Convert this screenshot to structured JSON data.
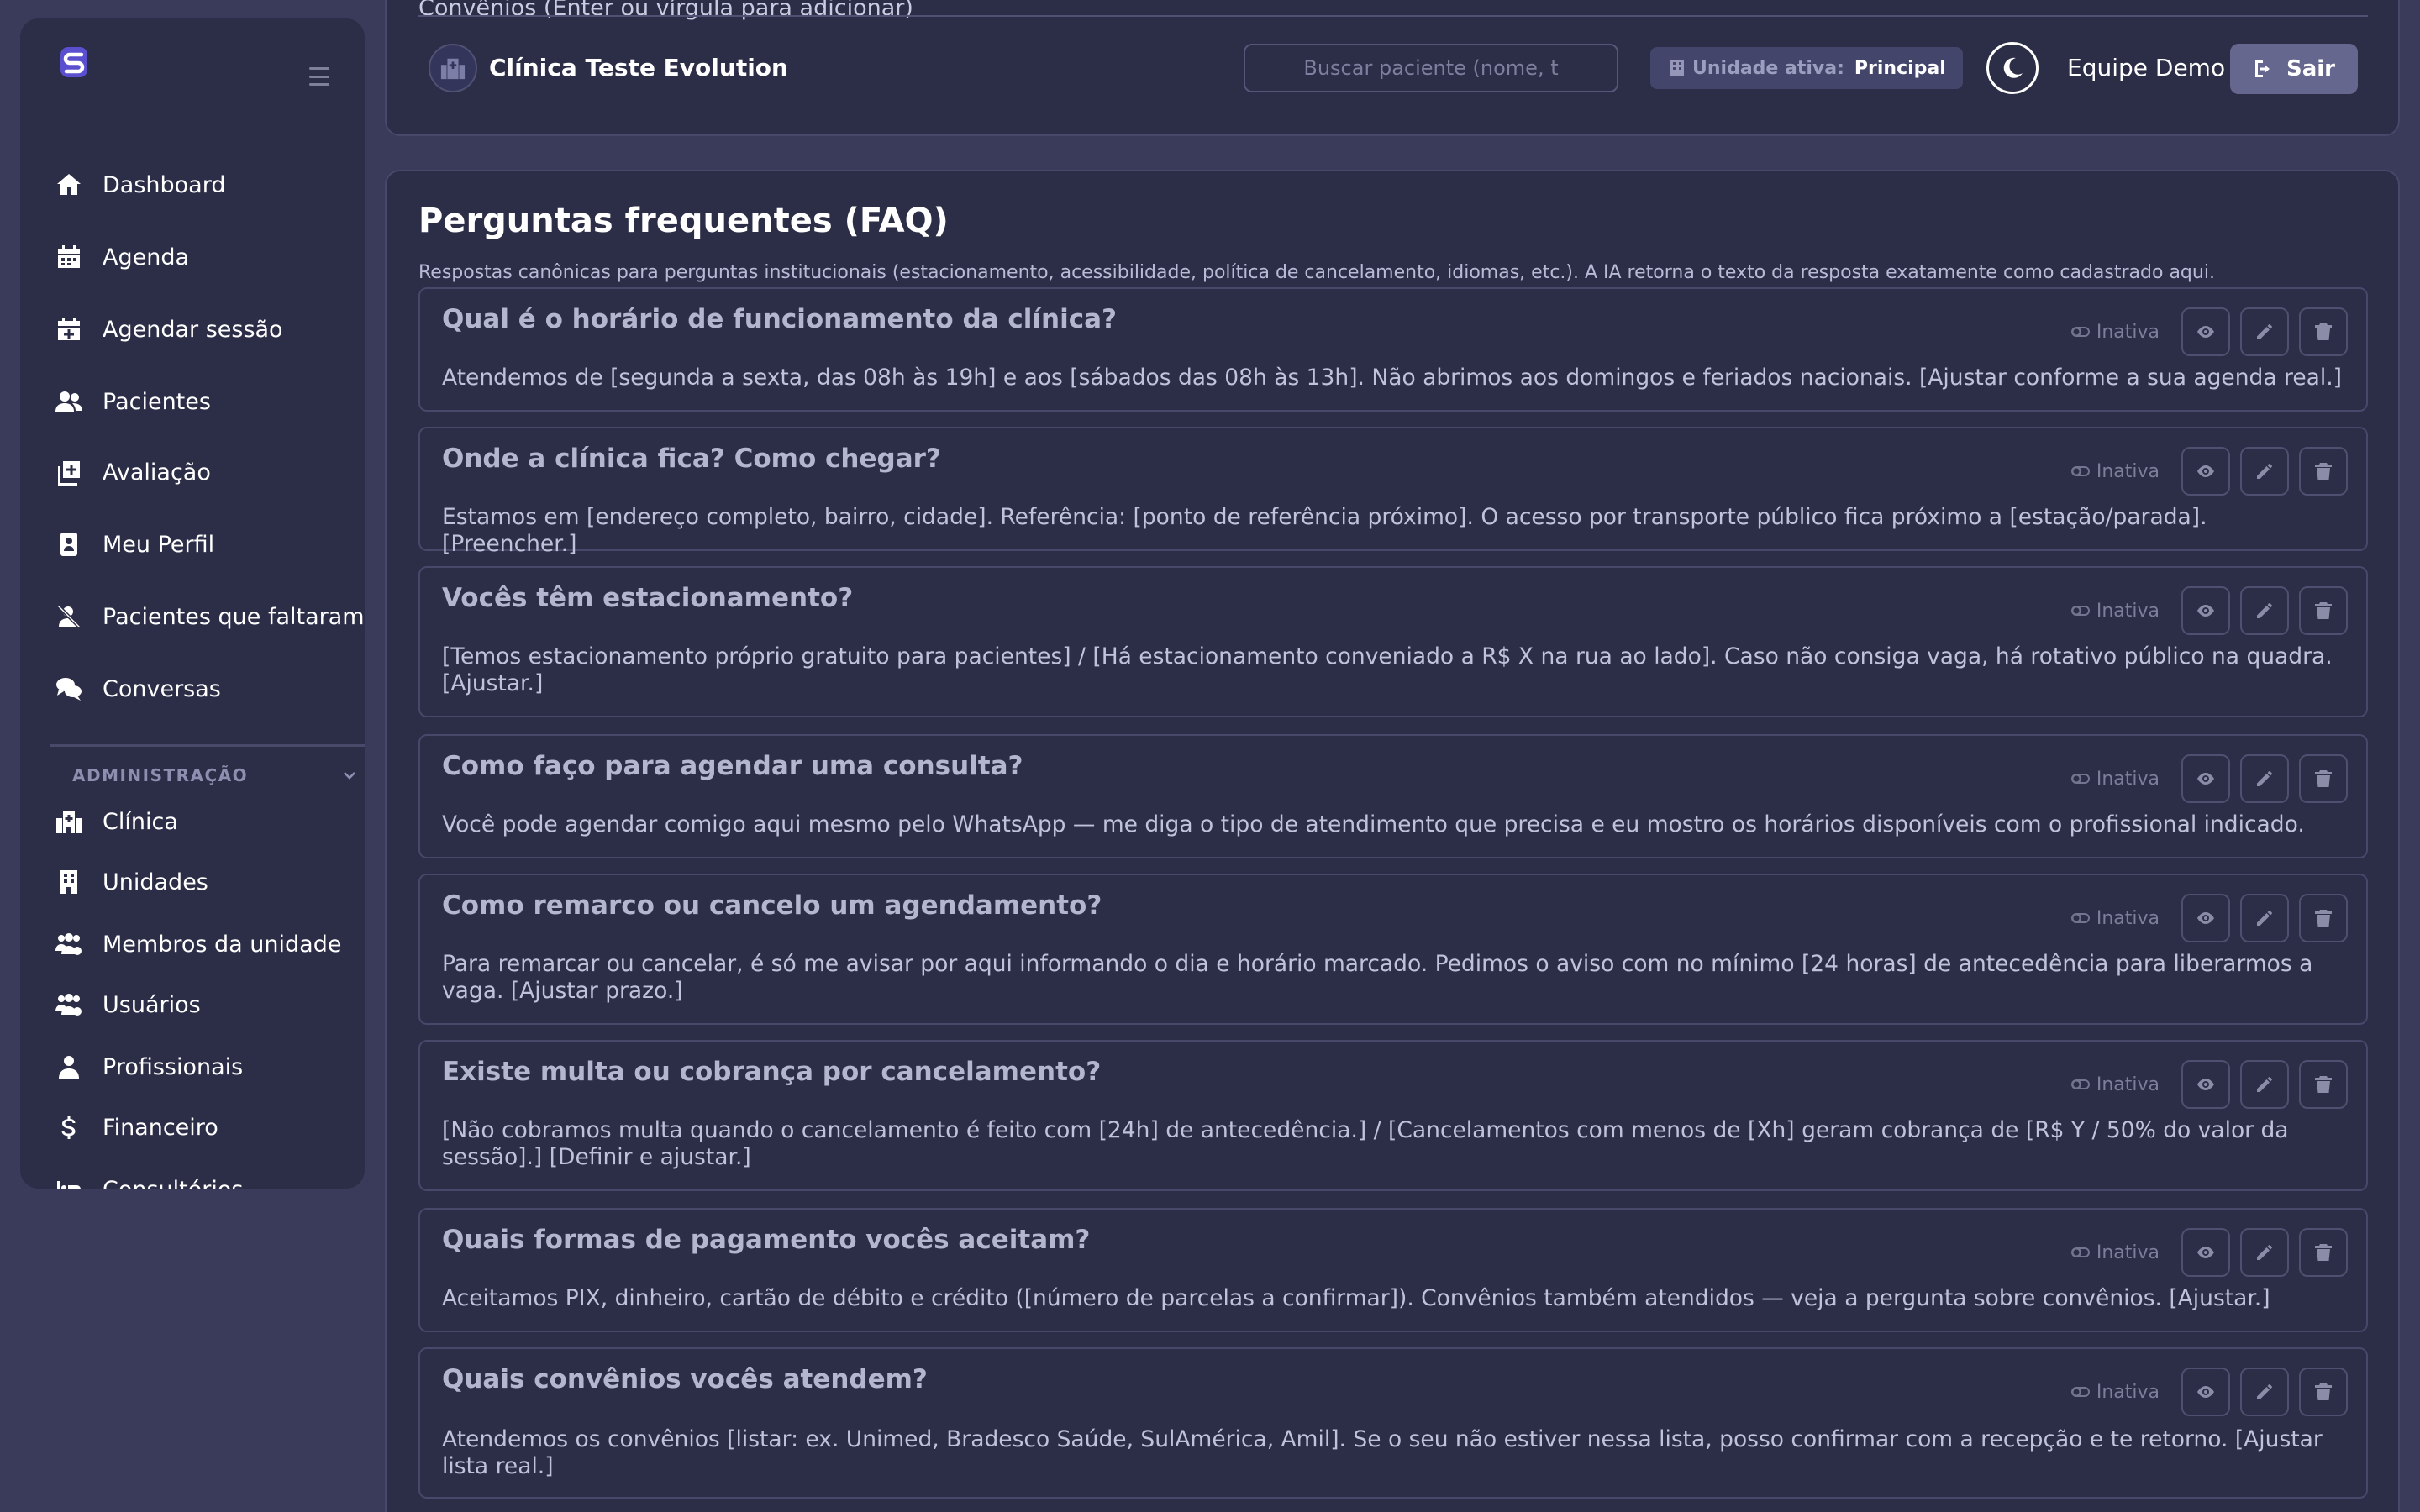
{
  "sidebar": {
    "nav": [
      {
        "label": "Dashboard",
        "icon": "home-icon"
      },
      {
        "label": "Agenda",
        "icon": "calendar-icon"
      },
      {
        "label": "Agendar sessão",
        "icon": "calendar-plus-icon"
      },
      {
        "label": "Pacientes",
        "icon": "users-icon"
      },
      {
        "label": "Avaliação",
        "icon": "clipboard-plus-icon"
      },
      {
        "label": "Meu Perfil",
        "icon": "id-badge-icon"
      },
      {
        "label": "Pacientes que faltaram",
        "icon": "user-slash-icon"
      },
      {
        "label": "Conversas",
        "icon": "comments-icon"
      }
    ],
    "admin_section": "ADMINISTRAÇÃO",
    "admin": [
      {
        "label": "Clínica",
        "icon": "hospital-icon"
      },
      {
        "label": "Unidades",
        "icon": "building-icon"
      },
      {
        "label": "Membros da unidade",
        "icon": "users-cog-icon"
      },
      {
        "label": "Usuários",
        "icon": "users-gear-icon"
      },
      {
        "label": "Profissionais",
        "icon": "user-doctor-icon"
      },
      {
        "label": "Financeiro",
        "icon": "dollar-icon"
      },
      {
        "label": "Consultórios",
        "icon": "bed-icon"
      }
    ]
  },
  "header": {
    "fragment_label": "Convênios (Enter ou vírgula para adicionar)",
    "clinic_name": "Clínica Teste Evolution",
    "search_placeholder": "Buscar paciente (nome, t",
    "unit_label": "Unidade ativa:",
    "unit_value": "Principal",
    "user_name": "Equipe Demo",
    "logout_label": "Sair"
  },
  "faq": {
    "title": "Perguntas frequentes (FAQ)",
    "subtitle": "Respostas canônicas para perguntas institucionais (estacionamento, acessibilidade, política de cancelamento, idiomas, etc.). A IA retorna o texto da resposta exatamente como cadastrado aqui.",
    "status_label": "Inativa",
    "items": [
      {
        "q": "Qual é o horário de funcionamento da clínica?",
        "a": "Atendemos de [segunda a sexta, das 08h às 19h] e aos [sábados das 08h às 13h]. Não abrimos aos domingos e feriados nacionais. [Ajustar conforme a sua agenda real.]"
      },
      {
        "q": "Onde a clínica fica? Como chegar?",
        "a": "Estamos em [endereço completo, bairro, cidade]. Referência: [ponto de referência próximo]. O acesso por transporte público fica próximo a [estação/parada]. [Preencher.]"
      },
      {
        "q": "Vocês têm estacionamento?",
        "a": "[Temos estacionamento próprio gratuito para pacientes] / [Há estacionamento conveniado a R$ X na rua ao lado]. Caso não consiga vaga, há rotativo público na quadra. [Ajustar.]"
      },
      {
        "q": "Como faço para agendar uma consulta?",
        "a": "Você pode agendar comigo aqui mesmo pelo WhatsApp — me diga o tipo de atendimento que precisa e eu mostro os horários disponíveis com o profissional indicado."
      },
      {
        "q": "Como remarco ou cancelo um agendamento?",
        "a": "Para remarcar ou cancelar, é só me avisar por aqui informando o dia e horário marcado. Pedimos o aviso com no mínimo [24 horas] de antecedência para liberarmos a vaga. [Ajustar prazo.]"
      },
      {
        "q": "Existe multa ou cobrança por cancelamento?",
        "a": "[Não cobramos multa quando o cancelamento é feito com [24h] de antecedência.] / [Cancelamentos com menos de [Xh] geram cobrança de [R$ Y / 50% do valor da sessão].] [Definir e ajustar.]"
      },
      {
        "q": "Quais formas de pagamento vocês aceitam?",
        "a": "Aceitamos PIX, dinheiro, cartão de débito e crédito ([número de parcelas a confirmar]). Convênios também atendidos — veja a pergunta sobre convênios. [Ajustar.]"
      },
      {
        "q": "Quais convênios vocês atendem?",
        "a": "Atendemos os convênios [listar: ex. Unimed, Bradesco Saúde, SulAmérica, Amil]. Se o seu não estiver nessa lista, posso confirmar com a recepção e te retorno. [Ajustar lista real.]"
      }
    ]
  }
}
